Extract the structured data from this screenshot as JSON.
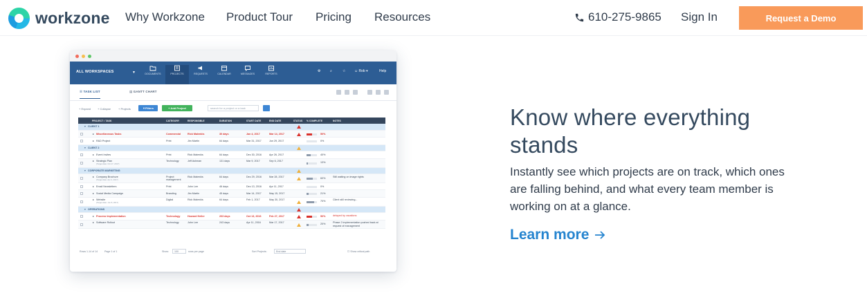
{
  "nav": {
    "logo_text": "workzone",
    "links": [
      "Why Workzone",
      "Product Tour",
      "Pricing",
      "Resources"
    ],
    "phone": "610-275-9865",
    "signin": "Sign In",
    "demo": "Request a Demo"
  },
  "app": {
    "workspace": "ALL WORKSPACES",
    "modules": [
      "DOCUMENTS",
      "PROJECTS",
      "REQUESTS",
      "CALENDAR",
      "MESSAGES",
      "REPORTS"
    ],
    "active_module": "PROJECTS",
    "user": "Rob",
    "help": "Help",
    "tabs": [
      "TASK LIST",
      "GANTT CHART"
    ],
    "toolbar": {
      "expand": "+ Expand",
      "collapse": "+ Collapse",
      "projects": "+ Projects",
      "filters": "Filters",
      "add_project": "+ Add Project",
      "search_placeholder": "search for a project or a task"
    },
    "columns": [
      "PROJECT / TASK",
      "CATEGORY",
      "RESPONSIBLE",
      "DURATION",
      "START DATE",
      "END DATE",
      "STATUS",
      "% COMPLETE",
      "NOTES"
    ],
    "rows": [
      {
        "type": "group",
        "name": "CLIENT 1",
        "warn": "red"
      },
      {
        "type": "task",
        "name": "Miscellaneous Tasks",
        "category": "Commercial",
        "responsible": "Rick Malenkis",
        "duration": "30 days",
        "start": "Jan 4, 2017",
        "end": "Mar 14, 2017",
        "warn": "red",
        "pct": "50%",
        "red": true
      },
      {
        "type": "task",
        "name": "R&D Project",
        "category": "Print",
        "responsible": "Jim Martin",
        "duration": "64 days",
        "start": "Mar 31, 2017",
        "end": "Jun 29, 2017",
        "pct": "0%"
      },
      {
        "type": "group",
        "name": "CLIENT 2",
        "warn": "amber"
      },
      {
        "type": "task",
        "name": "Event Invites",
        "category": "Print",
        "responsible": "Rick Malenkis",
        "duration": "64 days",
        "start": "Dec 30, 2016",
        "end": "Apr 26, 2017",
        "pct": "40%"
      },
      {
        "type": "task",
        "name": "Strategic Plan",
        "sub": "(Target date: Oct 17, 2017)",
        "category": "Technology",
        "responsible": "Jeff Ashman",
        "duration": "131 days",
        "start": "Mar 9, 2017",
        "end": "Sep 6, 2017",
        "pct": "13%",
        "tall": true
      },
      {
        "type": "group",
        "name": "CORPORATE MARKETING",
        "warn": "amber"
      },
      {
        "type": "task",
        "name": "Company Brochure",
        "sub": "(Target date: Apr 4, 2017)",
        "category": "Project management",
        "responsible": "Rick Malenkis",
        "duration": "64 days",
        "start": "Dec 29, 2016",
        "end": "Mar 28, 2017",
        "warn": "amber",
        "pct": "60%",
        "notes": "Still waiting on image rights",
        "tall": true
      },
      {
        "type": "task",
        "name": "Email Newsletters",
        "category": "Print",
        "responsible": "John Lee",
        "duration": "46 days",
        "start": "Dec 13, 2016",
        "end": "Apr 11, 2017",
        "pct": "0%"
      },
      {
        "type": "task",
        "name": "Social Media Campaign",
        "category": "Branding",
        "responsible": "Jim Martin",
        "duration": "45 days",
        "start": "Mar 14, 2017",
        "end": "May 15, 2017",
        "pct": "21%"
      },
      {
        "type": "task",
        "name": "Website",
        "sub": "(Target date: Jun 8, 2017)",
        "category": "Digital",
        "responsible": "Rick Malenkis",
        "duration": "64 days",
        "start": "Feb 1, 2017",
        "end": "May 30, 2017",
        "warn": "amber",
        "pct": "70%",
        "notes": "Client still reviewing...",
        "tall": true
      },
      {
        "type": "group",
        "name": "OPERATIONS",
        "warn": "red"
      },
      {
        "type": "task",
        "name": "Process Implementation",
        "category": "Technology",
        "responsible": "Howard Heller",
        "duration": "203 days",
        "start": "Oct 13, 2016",
        "end": "Feb 27, 2017",
        "warn": "red",
        "pct": "50%",
        "notes": "delayed by vacations",
        "red": true
      },
      {
        "type": "task",
        "name": "Software Rollout",
        "category": "Technology",
        "responsible": "John Lee",
        "duration": "243 days",
        "start": "Apr 11, 2016",
        "end": "Mar 17, 2017",
        "warn": "amber",
        "pct": "20%",
        "notes": "Phase 2 implementation pushed back at request of management",
        "tall": true
      }
    ],
    "footer": {
      "rows": "Rows 1-14 of 14",
      "page": "Page 1 of 1",
      "show": "Show:",
      "per_page": "100",
      "rows_per_page": "rows per page",
      "sort_label": "Sort Projects:",
      "sort_value": "End date",
      "critical": "Show critical path"
    }
  },
  "hero": {
    "headline": "Know where everything stands",
    "copy": "Instantly see which projects are on track, which ones are falling behind, and what every team member is working on at a glance.",
    "learn_more": "Learn more"
  },
  "colors": {
    "accent": "#f99a5a",
    "link": "#2584cf",
    "appbar": "#2d5d94",
    "red": "#d9312b",
    "amber": "#f0b03a"
  }
}
